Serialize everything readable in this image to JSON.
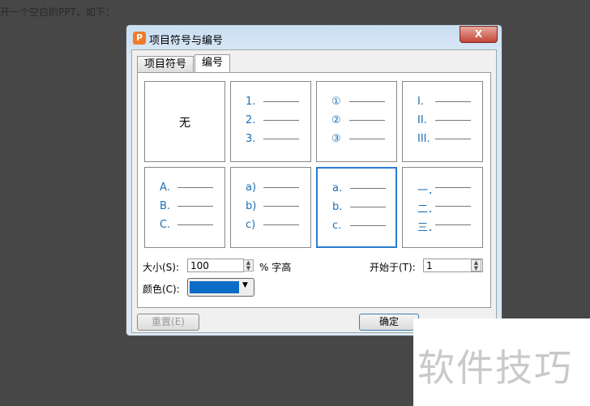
{
  "background_text": "开一个空白的PPT，如下：",
  "dialog": {
    "title": "项目符号与编号",
    "close_label": "X",
    "tabs": [
      {
        "label": "项目符号",
        "active": false
      },
      {
        "label": "编号",
        "active": true
      }
    ],
    "styles": [
      {
        "none": "无"
      },
      {
        "items": [
          "1.",
          "2.",
          "3."
        ]
      },
      {
        "items": [
          "①",
          "②",
          "③"
        ]
      },
      {
        "items": [
          "I.",
          "II.",
          "III."
        ]
      },
      {
        "items": [
          "A.",
          "B.",
          "C."
        ]
      },
      {
        "items": [
          "a)",
          "b)",
          "c)"
        ]
      },
      {
        "items": [
          "a.",
          "b.",
          "c."
        ],
        "selected": true
      },
      {
        "items": [
          "一．",
          "二．",
          "三．"
        ]
      }
    ],
    "size_label": "大小(S):",
    "size_value": "100",
    "size_unit": "% 字高",
    "start_label": "开始于(T):",
    "start_value": "1",
    "color_label": "颜色(C):",
    "color_value": "#0a6cc4",
    "reset_label": "重置(E)",
    "ok_label": "确定"
  },
  "watermark": "软件技巧"
}
